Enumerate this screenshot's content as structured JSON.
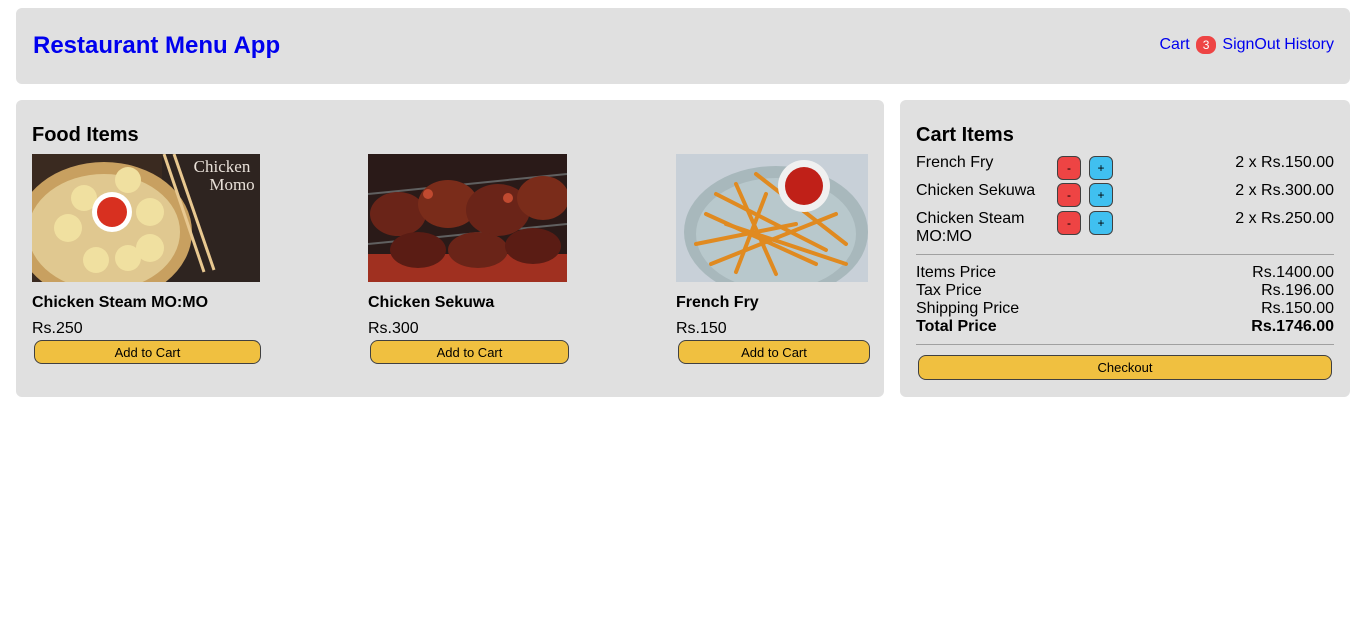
{
  "header": {
    "title": "Restaurant Menu App",
    "cart_label": "Cart",
    "cart_count": "3",
    "signout_label": "SignOut",
    "history_label": "History"
  },
  "food": {
    "title": "Food Items",
    "items": [
      {
        "name": "Chicken Steam MO:MO",
        "price": "Rs.250",
        "button": "Add to Cart",
        "image_caption": "Chicken Momo"
      },
      {
        "name": "Chicken Sekuwa",
        "price": "Rs.300",
        "button": "Add to Cart"
      },
      {
        "name": "French Fry",
        "price": "Rs.150",
        "button": "Add to Cart"
      }
    ]
  },
  "cart": {
    "title": "Cart Items",
    "items": [
      {
        "name": "French Fry",
        "minus": "-",
        "plus": "+",
        "qty": "2 x Rs.150.00"
      },
      {
        "name": "Chicken Sekuwa",
        "minus": "-",
        "plus": "+",
        "qty": "2 x Rs.300.00"
      },
      {
        "name": "Chicken Steam MO:MO",
        "minus": "-",
        "plus": "+",
        "qty": "2 x Rs.250.00"
      }
    ],
    "items_price_label": "Items Price",
    "items_price": "Rs.1400.00",
    "tax_price_label": "Tax Price",
    "tax_price": "Rs.196.00",
    "shipping_price_label": "Shipping Price",
    "shipping_price": "Rs.150.00",
    "total_price_label": "Total Price",
    "total_price": "Rs.1746.00",
    "checkout_label": "Checkout"
  },
  "colors": {
    "link": "#0000ee",
    "panel_bg": "#e0e0e0",
    "button_yellow": "#f0c040",
    "minus_red": "#ee4444",
    "plus_blue": "#40c0f0"
  }
}
